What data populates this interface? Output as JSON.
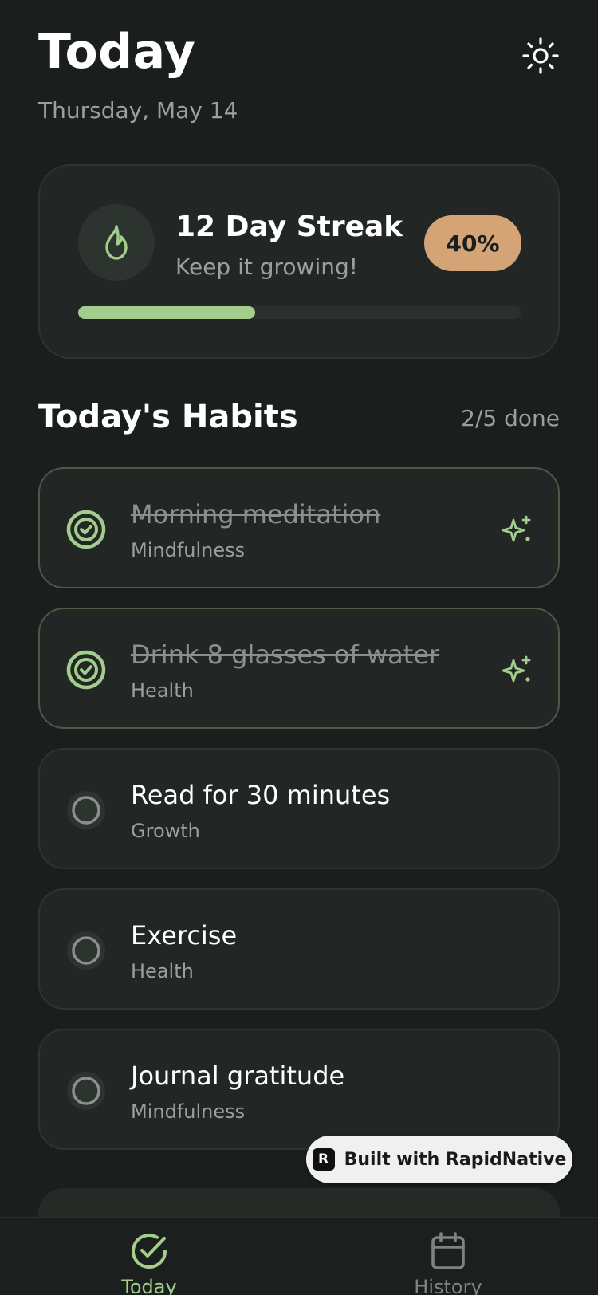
{
  "header": {
    "title": "Today",
    "date": "Thursday, May 14",
    "theme_icon": "sun-icon"
  },
  "streak": {
    "title": "12 Day Streak",
    "subtitle": "Keep it growing!",
    "percent_label": "40%",
    "progress": 0.4,
    "icon": "flame-icon"
  },
  "habits_section": {
    "title": "Today's Habits",
    "count": "2/5 done"
  },
  "habits": [
    {
      "name": "Morning meditation",
      "category": "Mindfulness",
      "done": true
    },
    {
      "name": "Drink 8 glasses of water",
      "category": "Health",
      "done": true
    },
    {
      "name": "Read for 30 minutes",
      "category": "Growth",
      "done": false
    },
    {
      "name": "Exercise",
      "category": "Health",
      "done": false
    },
    {
      "name": "Journal gratitude",
      "category": "Mindfulness",
      "done": false
    }
  ],
  "badge": {
    "label": "Built with RapidNative",
    "logo": "R"
  },
  "nav": {
    "today": "Today",
    "history": "History"
  },
  "colors": {
    "accent": "#a3cd8c",
    "badge": "#d4a477",
    "background": "#1a1e1c",
    "card": "#222725"
  }
}
